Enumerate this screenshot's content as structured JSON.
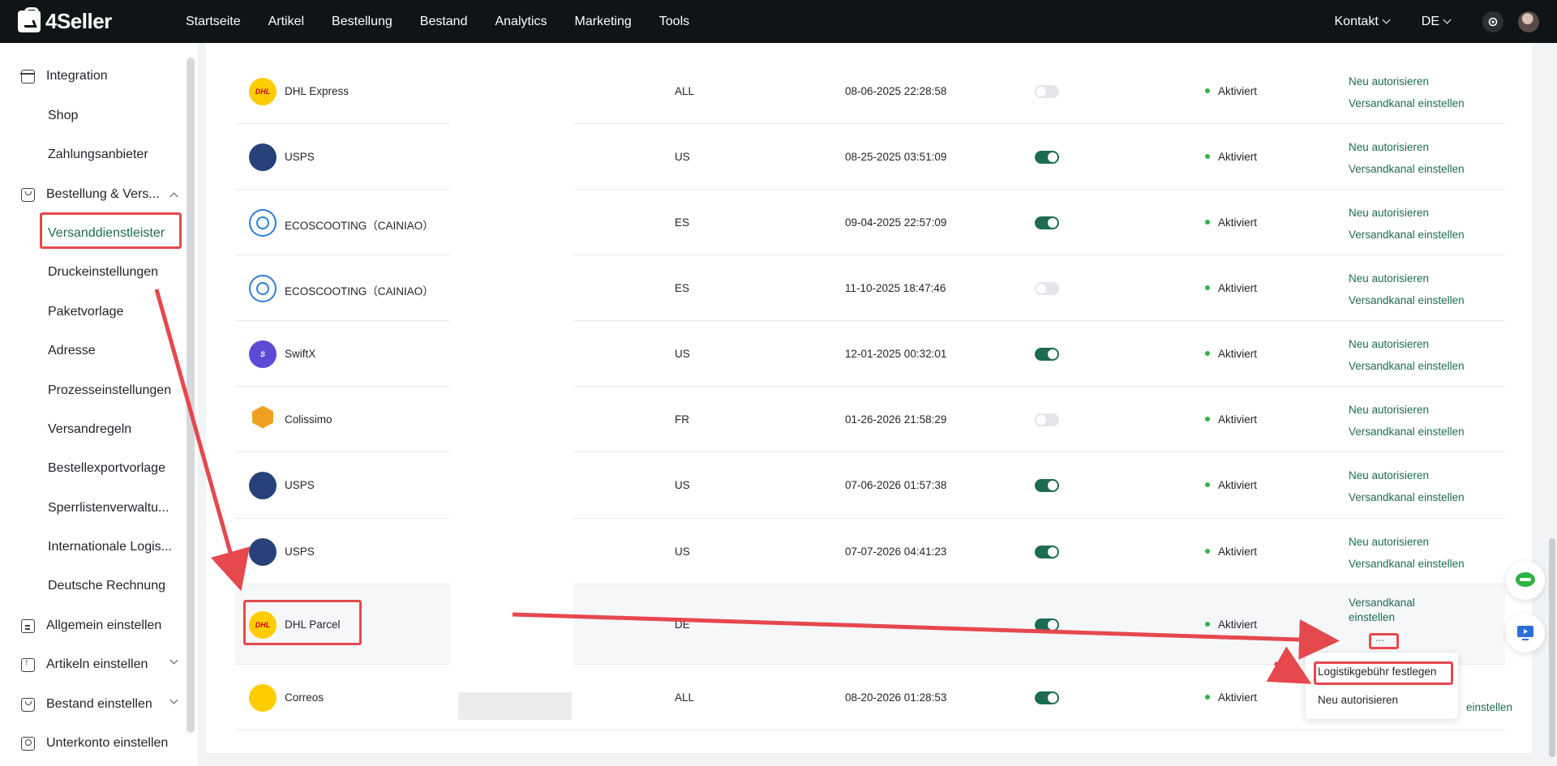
{
  "brand": {
    "name": "4Seller",
    "accent": "#1e6b53",
    "highlight": "#e5484d"
  },
  "topnav": {
    "items": [
      "Startseite",
      "Artikel",
      "Bestellung",
      "Bestand",
      "Analytics",
      "Marketing",
      "Tools"
    ],
    "contact": "Kontakt",
    "language": "DE",
    "icons": [
      "settings-icon",
      "avatar"
    ]
  },
  "sidebar": {
    "groups": [
      {
        "label": "Integration",
        "icon": "store-icon",
        "children": [
          "Shop",
          "Zahlungsanbieter"
        ]
      },
      {
        "label": "Bestellung & Vers...",
        "icon": "bag-icon",
        "expanded": true,
        "children": [
          "Versanddienstleister",
          "Druckeinstellungen",
          "Paketvorlage",
          "Adresse",
          "Prozesseinstellungen",
          "Versandregeln",
          "Bestellexportvorlage",
          "Sperrlistenverwaltu...",
          "Internationale Logis...",
          "Deutsche Rechnung"
        ]
      },
      {
        "label": "Allgemein einstellen",
        "icon": "doc-icon"
      },
      {
        "label": "Artikeln einstellen",
        "icon": "upload-icon"
      },
      {
        "label": "Bestand einstellen",
        "icon": "box-icon"
      },
      {
        "label": "Unterkonto einstellen",
        "icon": "user-icon"
      }
    ],
    "active": "Versanddienstleister"
  },
  "table": {
    "rows": [
      {
        "carrier": "DHL Express",
        "logo": "dhl-logo",
        "region": "ALL",
        "date": "08-06-2025 22:28:58",
        "enabled": false,
        "status": "Aktiviert"
      },
      {
        "carrier": "USPS",
        "logo": "usps-logo",
        "region": "US",
        "date": "08-25-2025 03:51:09",
        "enabled": true,
        "status": "Aktiviert"
      },
      {
        "carrier": "ECOSCOOTING（CAINIAO）",
        "logo": "eco-logo",
        "region": "ES",
        "date": "09-04-2025 22:57:09",
        "enabled": true,
        "status": "Aktiviert"
      },
      {
        "carrier": "ECOSCOOTING（CAINIAO）",
        "logo": "eco-logo",
        "region": "ES",
        "date": "11-10-2025 18:47:46",
        "enabled": false,
        "status": "Aktiviert"
      },
      {
        "carrier": "SwiftX",
        "logo": "swiftx-logo",
        "region": "US",
        "date": "12-01-2025 00:32:01",
        "enabled": true,
        "status": "Aktiviert"
      },
      {
        "carrier": "Colissimo",
        "logo": "colissimo-logo",
        "region": "FR",
        "date": "01-26-2026 21:58:29",
        "enabled": false,
        "status": "Aktiviert"
      },
      {
        "carrier": "USPS",
        "logo": "usps-logo",
        "region": "US",
        "date": "07-06-2026 01:57:38",
        "enabled": true,
        "status": "Aktiviert"
      },
      {
        "carrier": "USPS",
        "logo": "usps-logo",
        "region": "US",
        "date": "07-07-2026 04:41:23",
        "enabled": true,
        "status": "Aktiviert"
      },
      {
        "carrier": "DHL Parcel",
        "logo": "dhl-parcel-logo",
        "region": "DE",
        "date": "",
        "enabled": true,
        "status": "Aktiviert"
      },
      {
        "carrier": "Correos",
        "logo": "correos-logo",
        "region": "ALL",
        "date": "08-20-2026 01:28:53",
        "enabled": true,
        "status": "Aktiviert"
      }
    ],
    "actions": {
      "reauth": "Neu autorisieren",
      "channel": "Versandkanal einstellen",
      "channel_wrapped_1": "Versandkanal",
      "channel_wrapped_2": "einstellen",
      "more": "...",
      "last_row_tail": "einstellen"
    },
    "logo_text": {
      "dhl": "DHL",
      "parcel": "PARCEL",
      "swiftx": "S"
    }
  },
  "popover": {
    "items": [
      "Logistikgebühr festlegen",
      "Neu autorisieren"
    ]
  }
}
